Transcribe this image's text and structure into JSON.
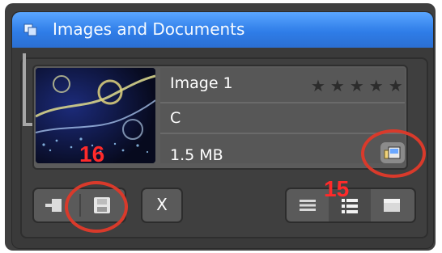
{
  "panel": {
    "title": "Images and Documents"
  },
  "item": {
    "name": "Image 1",
    "subtitle": "C",
    "size": "1.5 MB",
    "rating_stars": "★★★★★"
  },
  "toolbar": {
    "close_label": "X"
  },
  "annotations": {
    "num_left": "16",
    "num_right": "15",
    "ring_color": "#d93a2b"
  },
  "colors": {
    "title_bar": "#2f7de8",
    "panel_bg": "#3a3a3a",
    "text": "#ffffff"
  }
}
